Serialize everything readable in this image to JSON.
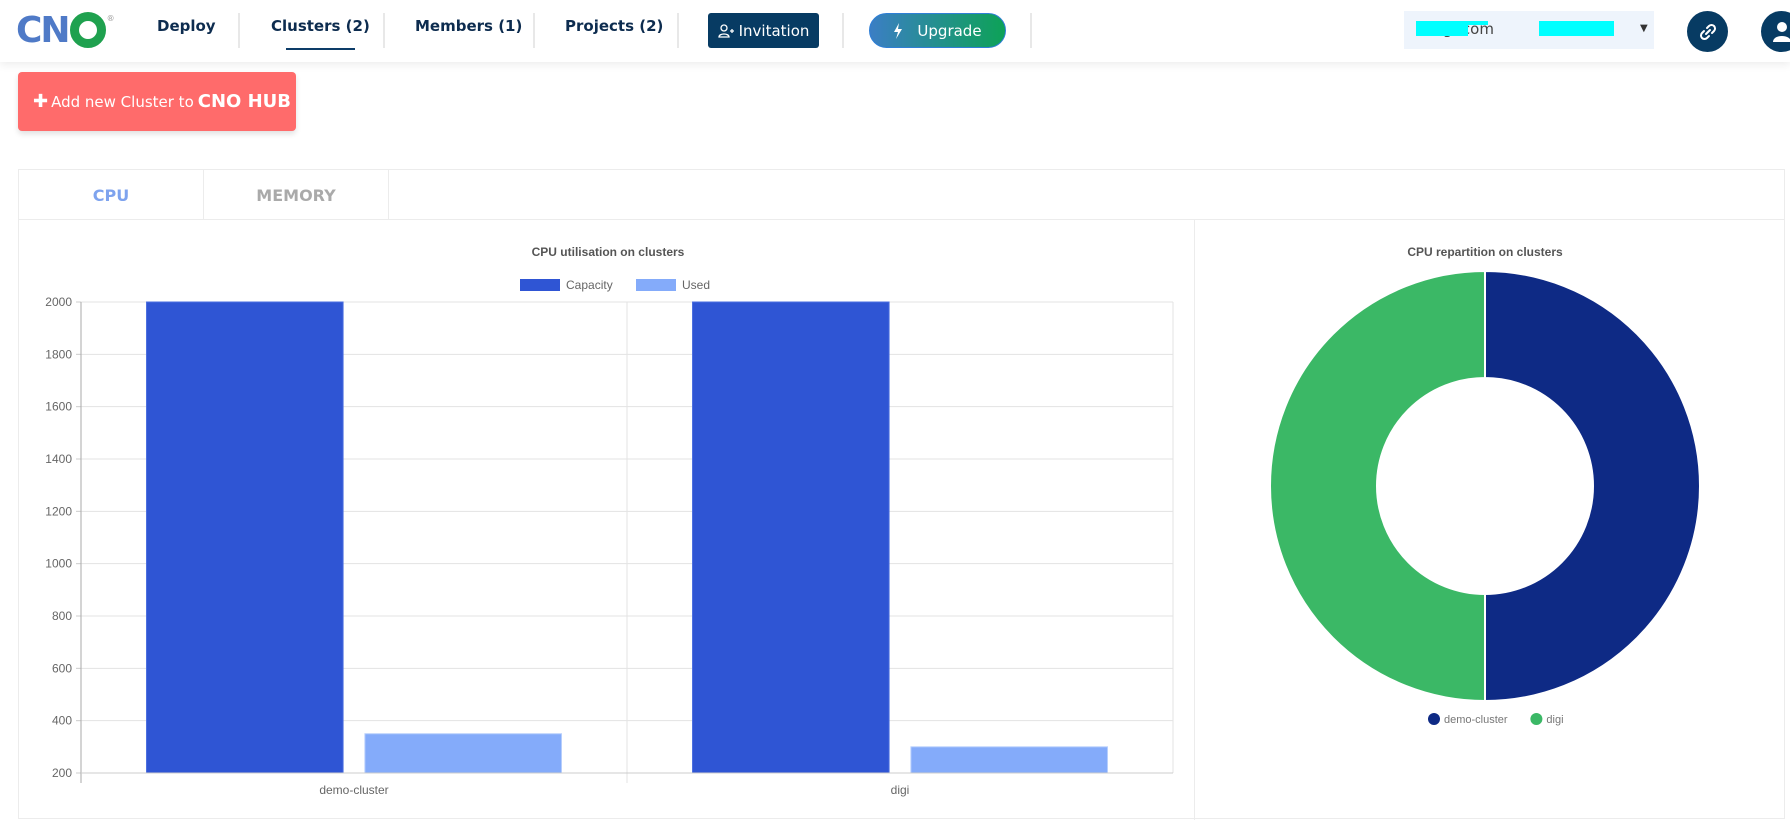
{
  "header": {
    "logo_text": [
      "C",
      "N"
    ],
    "nav": [
      {
        "label": "Deploy",
        "active": false
      },
      {
        "label": "Clusters (2)",
        "active": true
      },
      {
        "label": "Members (1)",
        "active": false
      },
      {
        "label": "Projects (2)",
        "active": false
      }
    ],
    "invitation_label": "Invitation",
    "upgrade_label": "Upgrade",
    "user_email_visible": "s          u  g          .com",
    "user_email_suffix": ".com",
    "icons": {
      "link": "link-icon",
      "user": "user-icon",
      "invite": "user-plus-icon",
      "upgrade": "lightning-icon"
    }
  },
  "actions": {
    "add_cluster_prefix": "Add new Cluster to",
    "add_cluster_brand": "CNO HUB"
  },
  "tabs": [
    {
      "label": "CPU",
      "active": true
    },
    {
      "label": "MEMORY",
      "active": false
    }
  ],
  "colors": {
    "capacity": "#2f55d4",
    "used": "#84abfa",
    "demo_cluster": "#0e2a85",
    "digi": "#3bb866",
    "add_button": "#ff6b6b",
    "nav_dark": "#073b63"
  },
  "chart_data": [
    {
      "type": "bar",
      "title": "CPU utilisation on clusters",
      "categories": [
        "demo-cluster",
        "digi"
      ],
      "series": [
        {
          "name": "Capacity",
          "values": [
            2000,
            2000
          ]
        },
        {
          "name": "Used",
          "values": [
            350,
            300
          ]
        }
      ],
      "xlabel": "",
      "ylabel": "",
      "ylim": [
        200,
        2000
      ],
      "yticks": [
        200,
        400,
        600,
        800,
        1000,
        1200,
        1400,
        1600,
        1800,
        2000
      ],
      "grid": true,
      "legend": "top-center"
    },
    {
      "type": "pie",
      "subtype": "doughnut",
      "title": "CPU repartition on clusters",
      "labels": [
        "demo-cluster",
        "digi"
      ],
      "values": [
        50,
        50
      ],
      "legend": "bottom-center"
    }
  ]
}
